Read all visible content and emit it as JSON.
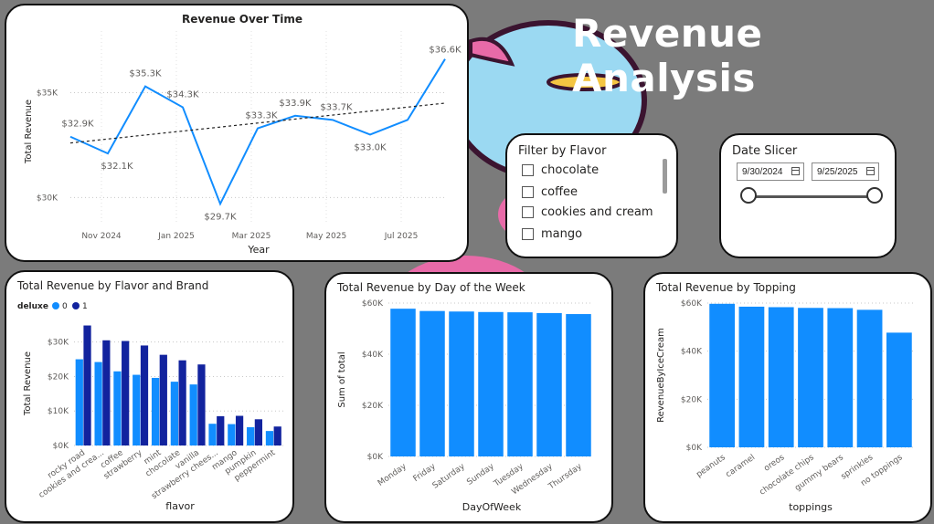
{
  "page": {
    "title": "Revenue Analysis"
  },
  "colors": {
    "accent": "#118dff",
    "dark_series": "#12239e",
    "light_series": "#118dff",
    "background": "#7b7b7b"
  },
  "flavor_filter": {
    "title": "Filter by Flavor",
    "items": [
      "chocolate",
      "coffee",
      "cookies and cream",
      "mango"
    ]
  },
  "date_slicer": {
    "title": "Date Slicer",
    "start": "9/30/2024",
    "end": "9/25/2025"
  },
  "charts": [
    {
      "id": "revenue_over_time",
      "title": "Revenue Over Time",
      "chart_data": {
        "type": "line",
        "title": "Revenue Over Time",
        "xlabel": "Year",
        "ylabel": "Total Revenue",
        "x_ticks": [
          "Nov 2024",
          "Jan 2025",
          "Mar 2025",
          "May 2025",
          "Jul 2025"
        ],
        "y_ticks": [
          "$30K",
          "$35K"
        ],
        "ylim": [
          28800,
          37500
        ],
        "points": [
          {
            "label": "$32.9K",
            "value": 32900
          },
          {
            "label": "$32.1K",
            "value": 32100
          },
          {
            "label": "$35.3K",
            "value": 35300
          },
          {
            "label": "$34.3K",
            "value": 34300
          },
          {
            "label": "$29.7K",
            "value": 29700
          },
          {
            "label": "$33.3K",
            "value": 33300
          },
          {
            "label": "$33.9K",
            "value": 33900
          },
          {
            "label": "$33.7K",
            "value": 33700
          },
          {
            "label": "$33.0K",
            "value": 33000
          },
          {
            "label": "",
            "value": 33700
          },
          {
            "label": "$36.6K",
            "value": 36600
          }
        ],
        "trendline": {
          "start": 32600,
          "end": 34500,
          "style": "dashed"
        }
      }
    },
    {
      "id": "flavor_brand",
      "title": "Total Revenue by Flavor and Brand",
      "chart_data": {
        "type": "bar",
        "title": "Total Revenue by Flavor and Brand",
        "xlabel": "flavor",
        "ylabel": "Total Revenue",
        "legend_title": "deluxe",
        "y_ticks": [
          "$0K",
          "$10K",
          "$20K",
          "$30K"
        ],
        "ylim": [
          0,
          36000
        ],
        "categories": [
          "rocky road",
          "cookies and crea...",
          "coffee",
          "strawberry",
          "mint",
          "chocolate",
          "vanilla",
          "strawberry chees...",
          "mango",
          "pumpkin",
          "peppermint"
        ],
        "series": [
          {
            "name": "0",
            "values": [
              25000,
              24200,
              21500,
              20500,
              19600,
              18500,
              17700,
              6300,
              6200,
              5300,
              4200
            ]
          },
          {
            "name": "1",
            "values": [
              34800,
              30500,
              30300,
              29000,
              26300,
              24700,
              23500,
              8500,
              8600,
              7600,
              5500
            ]
          }
        ]
      }
    },
    {
      "id": "day_of_week",
      "title": "Total Revenue by Day of the Week",
      "chart_data": {
        "type": "bar",
        "title": "Total Revenue by Day of the Week",
        "xlabel": "DayOfWeek",
        "ylabel": "Sum of total",
        "y_ticks": [
          "$0K",
          "$20K",
          "$40K",
          "$60K"
        ],
        "ylim": [
          0,
          60000
        ],
        "categories": [
          "Monday",
          "Friday",
          "Saturday",
          "Sunday",
          "Tuesday",
          "Wednesday",
          "Thursday"
        ],
        "values": [
          57800,
          56900,
          56700,
          56500,
          56400,
          56100,
          55700
        ]
      }
    },
    {
      "id": "topping",
      "title": "Total Revenue by Topping",
      "chart_data": {
        "type": "bar",
        "title": "Total Revenue by Topping",
        "xlabel": "toppings",
        "ylabel": "RevenueByIceCream",
        "y_ticks": [
          "$0K",
          "$20K",
          "$40K",
          "$60K"
        ],
        "ylim": [
          0,
          60000
        ],
        "categories": [
          "peanuts",
          "caramel",
          "oreos",
          "chocolate chips",
          "gummy bears",
          "sprinkles",
          "no toppings"
        ],
        "values": [
          59700,
          58500,
          58300,
          58000,
          57900,
          57200,
          47700
        ]
      }
    }
  ]
}
